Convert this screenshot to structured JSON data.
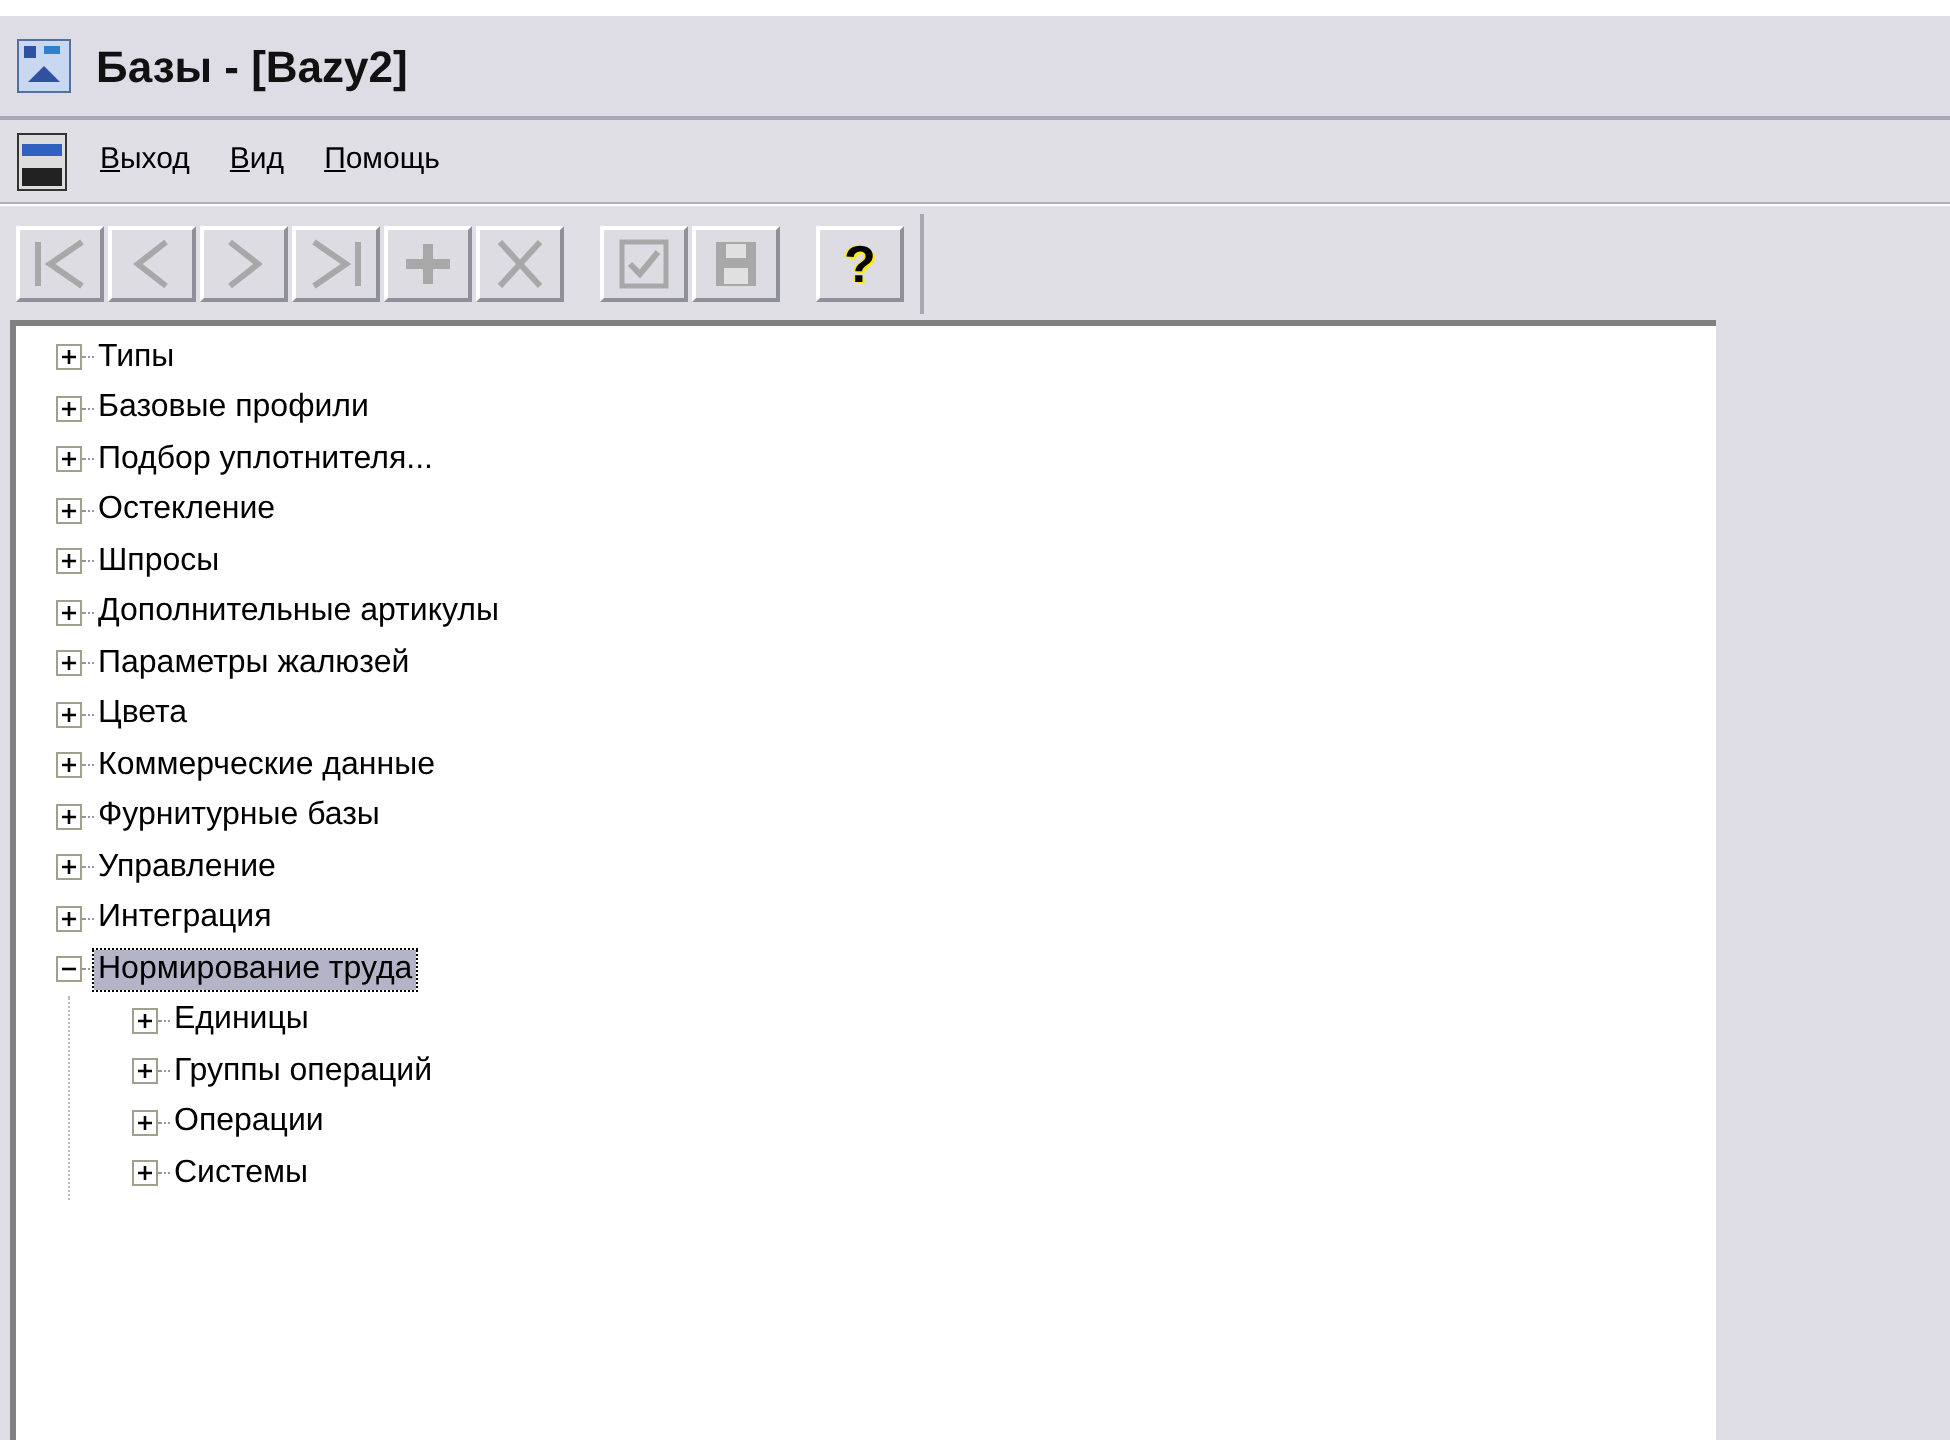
{
  "window": {
    "title": "Базы - [Bazy2]"
  },
  "menu": [
    {
      "label": "Выход"
    },
    {
      "label": "Вид"
    },
    {
      "label": "Помощь"
    }
  ],
  "toolbar": [
    {
      "kind": "first",
      "disabled": true
    },
    {
      "kind": "prev",
      "disabled": true
    },
    {
      "kind": "next",
      "disabled": true
    },
    {
      "kind": "last",
      "disabled": true
    },
    {
      "kind": "add",
      "disabled": true
    },
    {
      "kind": "delete",
      "disabled": true
    },
    {
      "kind": "separator"
    },
    {
      "kind": "confirm",
      "disabled": true
    },
    {
      "kind": "save",
      "disabled": true
    },
    {
      "kind": "separator"
    },
    {
      "kind": "help",
      "disabled": false,
      "glyph": "?"
    }
  ],
  "tree": [
    {
      "label": "Типы",
      "expanded": false,
      "selected": false
    },
    {
      "label": "Базовые профили",
      "expanded": false,
      "selected": false
    },
    {
      "label": "Подбор уплотнителя...",
      "expanded": false,
      "selected": false
    },
    {
      "label": "Остекление",
      "expanded": false,
      "selected": false
    },
    {
      "label": "Шпросы",
      "expanded": false,
      "selected": false
    },
    {
      "label": "Дополнительные артикулы",
      "expanded": false,
      "selected": false
    },
    {
      "label": "Параметры жалюзей",
      "expanded": false,
      "selected": false
    },
    {
      "label": "Цвета",
      "expanded": false,
      "selected": false
    },
    {
      "label": "Коммерческие данные",
      "expanded": false,
      "selected": false
    },
    {
      "label": "Фурнитурные базы",
      "expanded": false,
      "selected": false
    },
    {
      "label": "Управление",
      "expanded": false,
      "selected": false
    },
    {
      "label": "Интеграция",
      "expanded": false,
      "selected": false
    },
    {
      "label": "Нормирование труда",
      "expanded": true,
      "selected": true,
      "children": [
        {
          "label": "Единицы",
          "expanded": false,
          "selected": false
        },
        {
          "label": "Группы операций",
          "expanded": false,
          "selected": false
        },
        {
          "label": "Операции",
          "expanded": false,
          "selected": false
        },
        {
          "label": "Системы",
          "expanded": false,
          "selected": false
        }
      ]
    }
  ]
}
